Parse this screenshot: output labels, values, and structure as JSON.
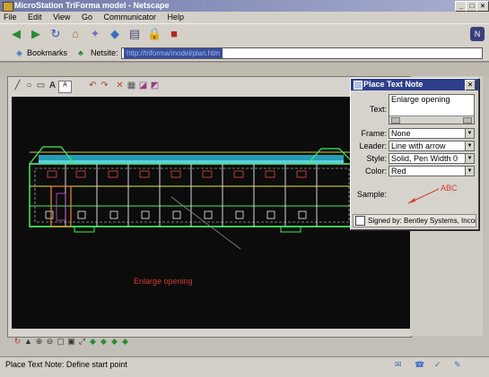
{
  "window": {
    "title": "MicroStation TriForma model - Netscape"
  },
  "menu": {
    "items": [
      "File",
      "Edit",
      "View",
      "Go",
      "Communicator",
      "Help"
    ]
  },
  "location": {
    "bookmarks_label": "Bookmarks",
    "netsite_label": "Netsite:",
    "url": "http://triforma/model/plan.htm"
  },
  "drawing": {
    "annotation": "Enlarge opening"
  },
  "dialog": {
    "title": "Place Text Note",
    "text_label": "Text:",
    "text_value": "Enlarge opening",
    "frame_label": "Frame:",
    "frame_value": "None",
    "leader_label": "Leader:",
    "leader_value": "Line with arrow",
    "style_label": "Style:",
    "style_value": "Solid, Pen Width 0",
    "color_label": "Color:",
    "color_value": "Red",
    "sample_label": "Sample:",
    "sample_text": "ABC",
    "signed_text": "Signed by: Bentley Systems, Incorporated"
  },
  "status": {
    "prompt": "Place Text Note: Define start point"
  },
  "colors": {
    "title_bar": "#2d3f8c",
    "canvas_bg": "#0c0c0c",
    "annotation_red": "#d23a32"
  }
}
